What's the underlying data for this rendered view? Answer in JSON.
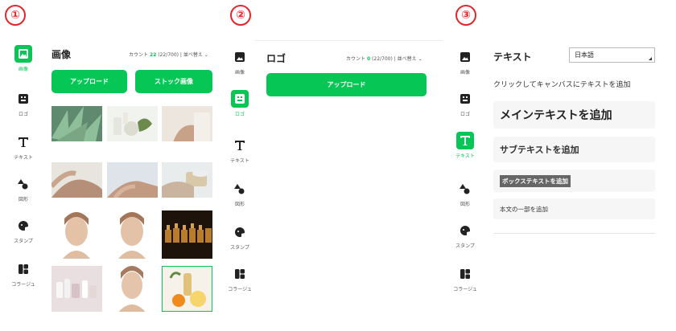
{
  "step_badges": [
    "①",
    "②",
    "③"
  ],
  "sidebar": {
    "items": [
      {
        "key": "image",
        "label": "画像",
        "icon": "image-icon"
      },
      {
        "key": "logo",
        "label": "ロゴ",
        "icon": "logo-icon"
      },
      {
        "key": "text",
        "label": "テキスト",
        "icon": "text-icon"
      },
      {
        "key": "shape",
        "label": "図形",
        "icon": "shape-icon"
      },
      {
        "key": "stamp",
        "label": "スタンプ",
        "icon": "stamp-icon"
      },
      {
        "key": "collage",
        "label": "コラージュ",
        "icon": "collage-icon"
      }
    ]
  },
  "panel1": {
    "active": "image",
    "title": "画像",
    "counter_prefix": "カウント",
    "counter_count": "22",
    "counter_rest": "(22/700) | 並べ替え",
    "upload_label": "アップロード",
    "stock_label": "ストック画像",
    "images": [
      "aloe plant leaves",
      "skincare products with herbs",
      "hand applying cream",
      "hands with lotion",
      "hands with lotion",
      "cream jar and towel",
      "woman touching face",
      "woman touching face",
      "amber dropper bottles",
      "cosmetic bottles on pink",
      "woman touching face",
      "oil bottle with orange"
    ]
  },
  "panel2": {
    "active": "logo",
    "title": "ロゴ",
    "counter_prefix": "カウント",
    "counter_count": "0",
    "counter_rest": "(22/700) | 並べ替え",
    "upload_label": "アップロード"
  },
  "panel3": {
    "active": "text",
    "title": "テキスト",
    "language": "日本語",
    "hint": "クリックしてキャンバスにテキストを追加",
    "main_text": "メインテキストを追加",
    "sub_text": "サブテキストを追加",
    "box_text": "ボックステキストを追加",
    "body_text": "本文の一部を追加"
  },
  "colors": {
    "accent": "#06c755",
    "badge": "#e3262a"
  }
}
